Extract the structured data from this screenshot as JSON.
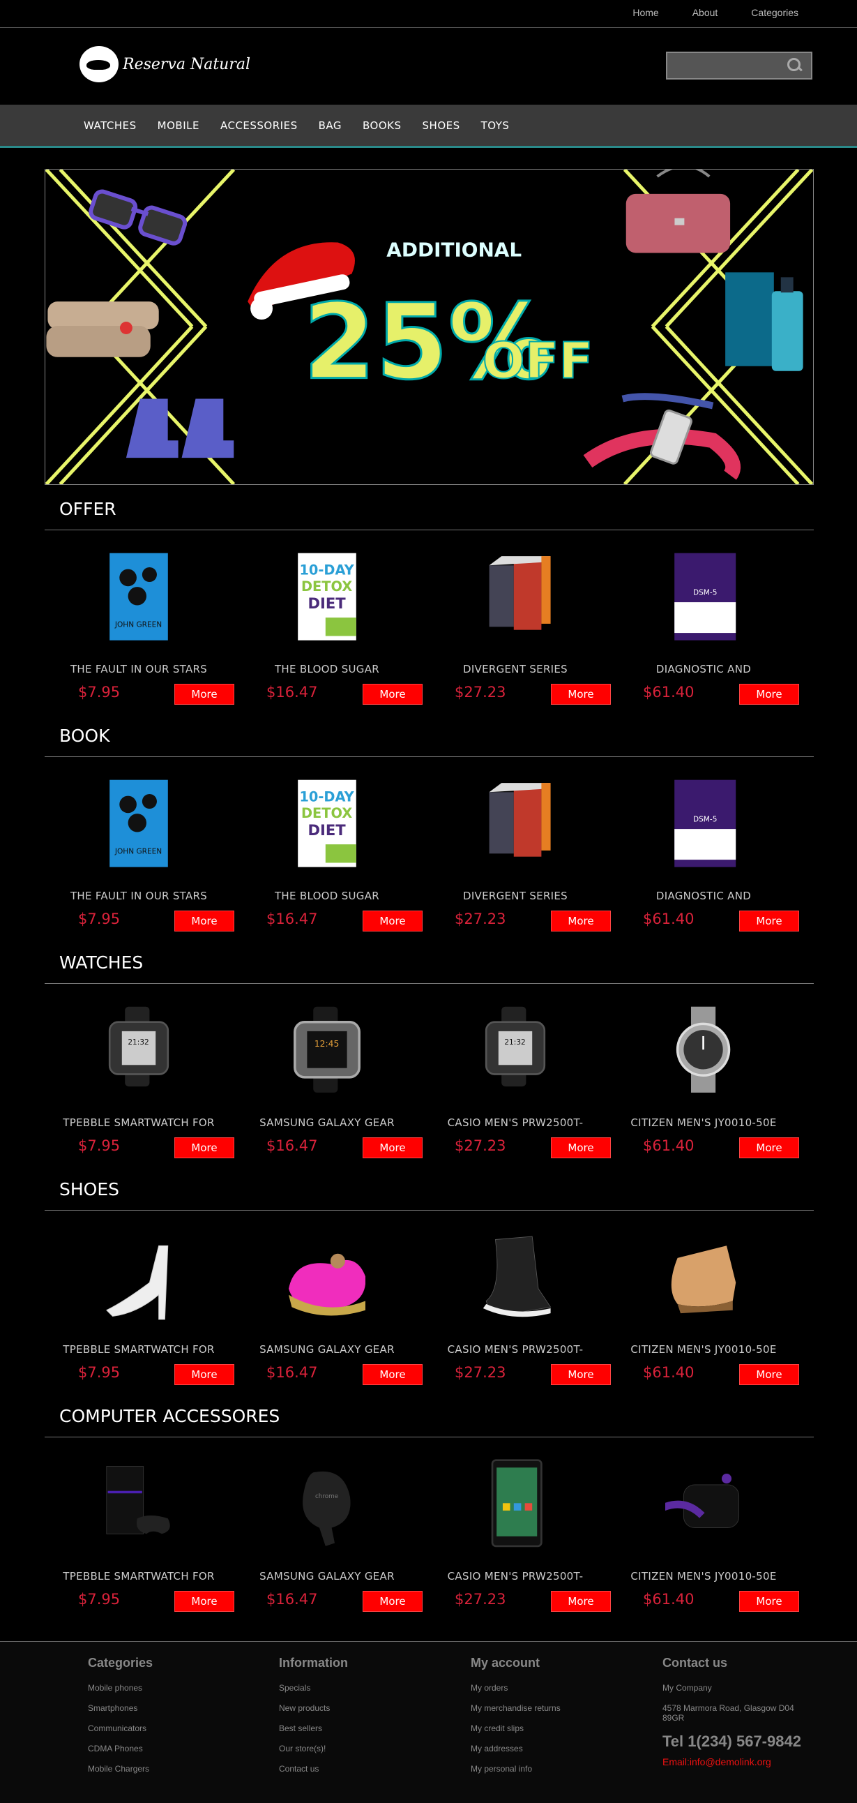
{
  "topnav": [
    "Home",
    "About",
    "Categories"
  ],
  "brand": {
    "name": "Reserva Natural"
  },
  "search": {
    "placeholder": ""
  },
  "catnav": [
    "WATCHES",
    "MOBILE",
    "ACCESSORIES",
    "BAG",
    "BOOKS",
    "SHOES",
    "TOYS"
  ],
  "banner": {
    "line1": "ADDITIONAL",
    "line2": "25%",
    "line3": "OFF"
  },
  "sections": [
    {
      "title": "OFFER",
      "products": [
        {
          "name": "THE FAULT IN OUR STARS",
          "price": "$7.95",
          "more": "More",
          "thumb": "book-blue"
        },
        {
          "name": "THE BLOOD SUGAR",
          "price": "$16.47",
          "more": "More",
          "thumb": "book-detox"
        },
        {
          "name": "DIVERGENT SERIES",
          "price": "$27.23",
          "more": "More",
          "thumb": "book-box"
        },
        {
          "name": "DIAGNOSTIC AND",
          "price": "$61.40",
          "more": "More",
          "thumb": "book-purple"
        }
      ]
    },
    {
      "title": "BOOK",
      "products": [
        {
          "name": "THE FAULT IN OUR STARS",
          "price": "$7.95",
          "more": "More",
          "thumb": "book-blue"
        },
        {
          "name": "THE BLOOD SUGAR",
          "price": "$16.47",
          "more": "More",
          "thumb": "book-detox"
        },
        {
          "name": "DIVERGENT SERIES",
          "price": "$27.23",
          "more": "More",
          "thumb": "book-box"
        },
        {
          "name": "DIAGNOSTIC AND",
          "price": "$61.40",
          "more": "More",
          "thumb": "book-purple"
        }
      ]
    },
    {
      "title": "WATCHES",
      "products": [
        {
          "name": "TPEBBLE SMARTWATCH FOR",
          "price": "$7.95",
          "more": "More",
          "thumb": "watch-pebble"
        },
        {
          "name": "SAMSUNG GALAXY GEAR",
          "price": "$16.47",
          "more": "More",
          "thumb": "watch-gear"
        },
        {
          "name": "CASIO MEN'S PRW2500T-",
          "price": "$27.23",
          "more": "More",
          "thumb": "watch-pebble"
        },
        {
          "name": "CITIZEN MEN'S JY0010-50E",
          "price": "$61.40",
          "more": "More",
          "thumb": "watch-citizen"
        }
      ]
    },
    {
      "title": "SHOES",
      "products": [
        {
          "name": "TPEBBLE SMARTWATCH FOR",
          "price": "$7.95",
          "more": "More",
          "thumb": "shoe-heel"
        },
        {
          "name": "SAMSUNG GALAXY GEAR",
          "price": "$16.47",
          "more": "More",
          "thumb": "shoe-pink"
        },
        {
          "name": "CASIO MEN'S PRW2500T-",
          "price": "$27.23",
          "more": "More",
          "thumb": "shoe-sneaker"
        },
        {
          "name": "CITIZEN MEN'S JY0010-50E",
          "price": "$61.40",
          "more": "More",
          "thumb": "shoe-wedge"
        }
      ]
    },
    {
      "title": "COMPUTER ACCESSORES",
      "products": [
        {
          "name": "TPEBBLE SMARTWATCH FOR",
          "price": "$7.95",
          "more": "More",
          "thumb": "console"
        },
        {
          "name": "SAMSUNG GALAXY GEAR",
          "price": "$16.47",
          "more": "More",
          "thumb": "chromecast"
        },
        {
          "name": "CASIO MEN'S PRW2500T-",
          "price": "$27.23",
          "more": "More",
          "thumb": "tablet"
        },
        {
          "name": "CITIZEN MEN'S JY0010-50E",
          "price": "$61.40",
          "more": "More",
          "thumb": "roku"
        }
      ]
    }
  ],
  "footer": {
    "categories": {
      "title": "Categories",
      "items": [
        "Mobile phones",
        "Smartphones",
        "Communicators",
        "CDMA Phones",
        "Mobile Chargers"
      ]
    },
    "information": {
      "title": "Information",
      "items": [
        "Specials",
        "New products",
        "Best sellers",
        "Our store(s)!",
        "Contact us"
      ]
    },
    "account": {
      "title": "My account",
      "items": [
        "My orders",
        "My merchandise returns",
        "My credit slips",
        "My addresses",
        "My personal info"
      ]
    },
    "contact": {
      "title": "Contact us",
      "company": "My Company",
      "address": "4578 Marmora Road, Glasgow D04 89GR",
      "tel": "Tel 1(234) 567-9842",
      "email": "Email:info@demolink.org"
    }
  },
  "colors": {
    "accent": "#ff0000",
    "price": "#d9223a",
    "navbar": "#3a3a3a",
    "banner_lines": "#e8f56a"
  }
}
